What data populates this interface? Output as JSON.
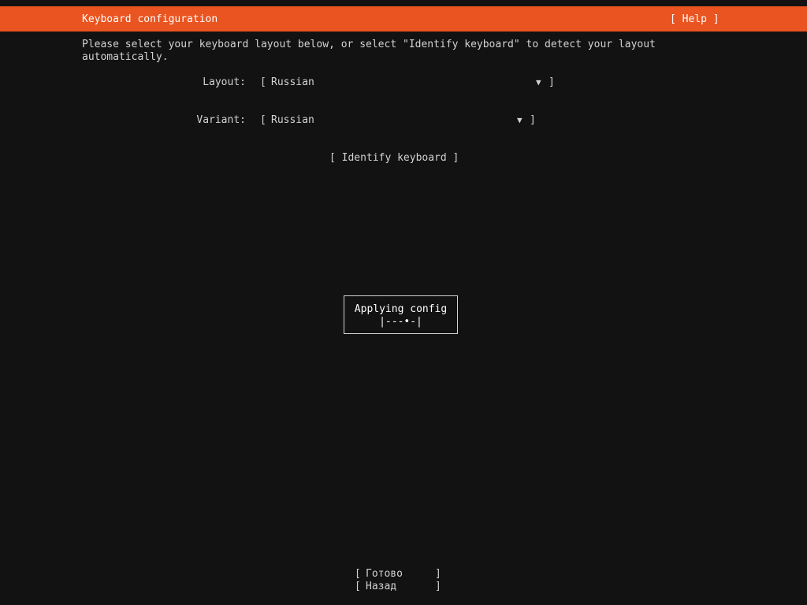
{
  "header": {
    "title": "Keyboard configuration",
    "help_label": "[ Help ]"
  },
  "instructions": "Please select your keyboard layout below, or select \"Identify keyboard\" to detect your layout\nautomatically.",
  "form": {
    "layout_label": "Layout:",
    "layout_value": "Russian",
    "variant_label": "Variant:",
    "variant_value": "Russian",
    "bracket_open": "[",
    "bracket_close": "]",
    "dropdown_arrow": "▼"
  },
  "identify_button": "[ Identify keyboard ]",
  "dialog": {
    "title": "Applying config",
    "spinner": "|---•-|"
  },
  "footer": {
    "done_label": "Готово",
    "back_label": "Назад",
    "bracket_open": "[",
    "bracket_close": "]"
  },
  "colors": {
    "accent": "#e95420",
    "background": "#121212",
    "text": "#d3d3d3"
  }
}
